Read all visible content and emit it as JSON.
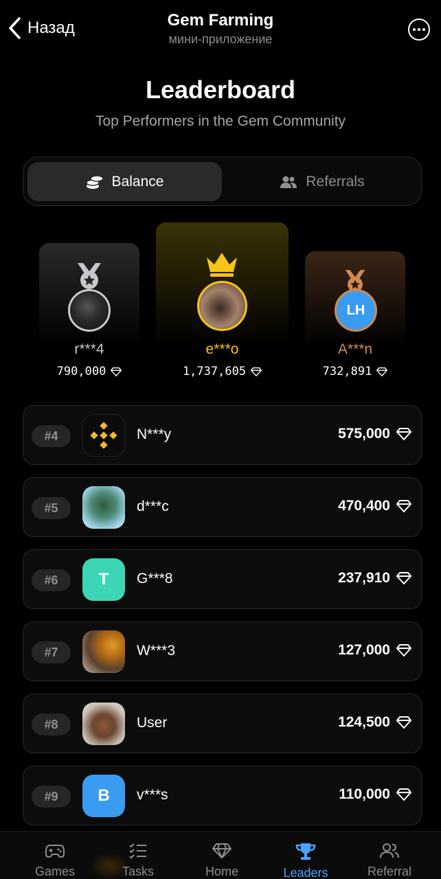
{
  "header": {
    "back_label": "Назад",
    "title": "Gem Farming",
    "subtitle": "мини-приложение"
  },
  "page": {
    "title": "Leaderboard",
    "subtitle": "Top Performers in the Gem Community"
  },
  "tabs": [
    {
      "label": "Balance",
      "icon": "coins-stack-icon",
      "active": true
    },
    {
      "label": "Referrals",
      "icon": "users-icon",
      "active": false
    }
  ],
  "podium": {
    "second": {
      "name": "r***4",
      "value": "790,000",
      "medal": "silver-medal-icon",
      "color": "#c7c7cc"
    },
    "first": {
      "name": "e***o",
      "value": "1,737,605",
      "medal": "gold-crown-icon",
      "color": "#f5c518"
    },
    "third": {
      "name": "A***n",
      "value": "732,891",
      "medal": "bronze-medal-icon",
      "color": "#d08a52",
      "avatar_initials": "LH"
    }
  },
  "leaders": [
    {
      "rank": "#4",
      "name": "N***y",
      "value": "575,000"
    },
    {
      "rank": "#5",
      "name": "d***c",
      "value": "470,400"
    },
    {
      "rank": "#6",
      "name": "G***8",
      "value": "237,910",
      "initial": "T"
    },
    {
      "rank": "#7",
      "name": "W***3",
      "value": "127,000"
    },
    {
      "rank": "#8",
      "name": "User",
      "value": "124,500"
    },
    {
      "rank": "#9",
      "name": "v***s",
      "value": "110,000",
      "initial": "B"
    }
  ],
  "nav": [
    {
      "label": "Games",
      "icon": "gamepad-icon"
    },
    {
      "label": "Tasks",
      "icon": "checklist-icon"
    },
    {
      "label": "Home",
      "icon": "diamond-icon"
    },
    {
      "label": "Leaders",
      "icon": "trophy-icon",
      "active": true
    },
    {
      "label": "Referral",
      "icon": "users-icon"
    }
  ],
  "colors": {
    "accent": "#4aa3ff",
    "gold": "#f5c518",
    "bronze": "#d08a52",
    "teal": "#3dd6b5",
    "blue": "#3a9cf0"
  }
}
